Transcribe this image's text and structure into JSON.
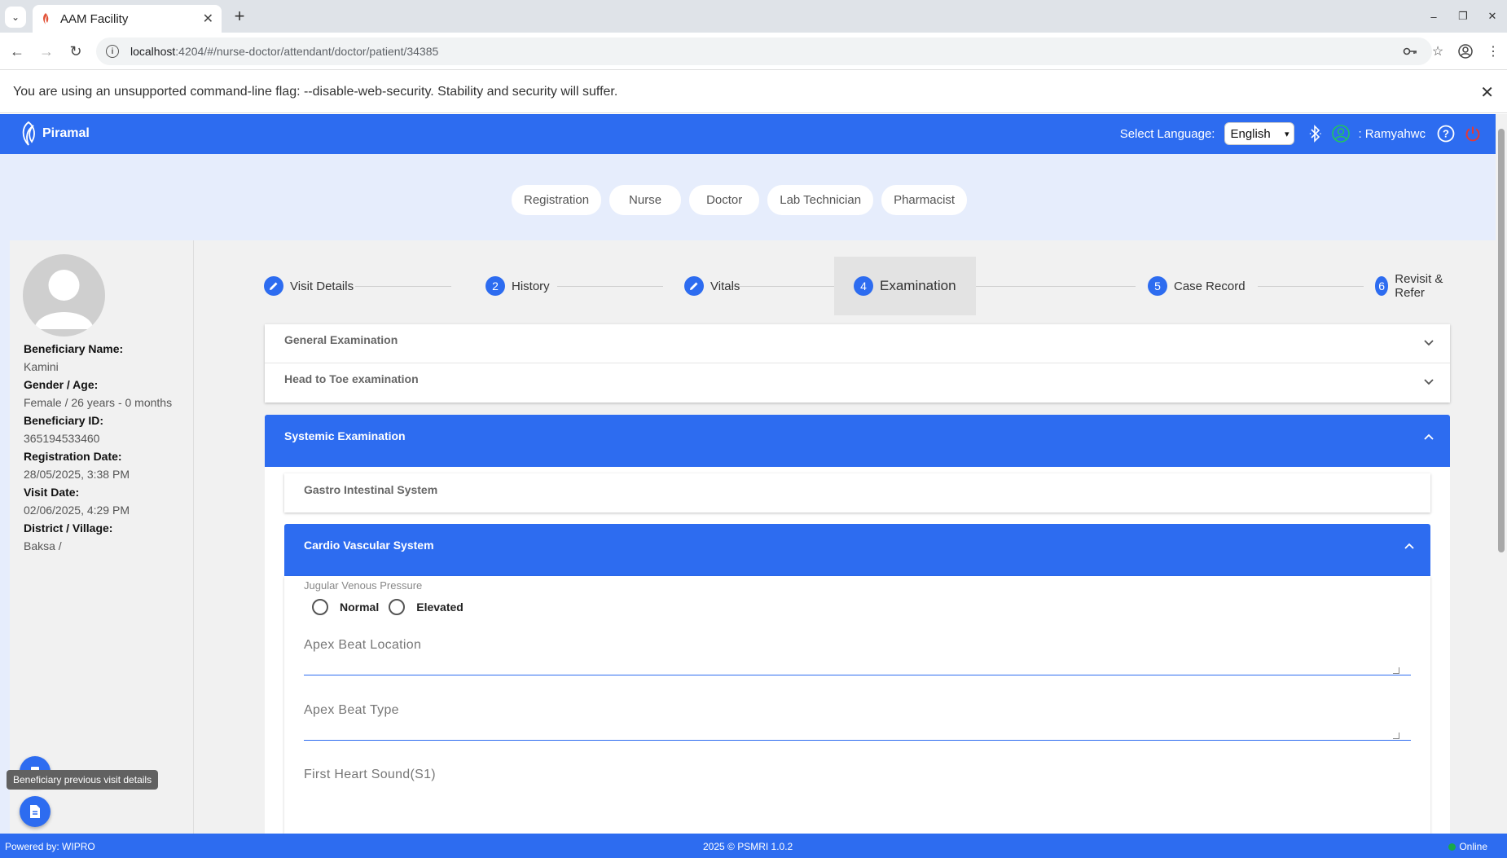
{
  "browser": {
    "tab_title": "AAM Facility",
    "url_host": "localhost",
    "url_path": ":4204/#/nurse-doctor/attendant/doctor/patient/34385",
    "infobar_text": "You are using an unsupported command-line flag: --disable-web-security. Stability and security will suffer."
  },
  "header": {
    "logo_text": "Piramal",
    "language_label": "Select Language:",
    "language_value": "English",
    "user_name": ": Ramyahwc",
    "brand_color": "#2d6cf0"
  },
  "role_tabs": [
    "Registration",
    "Nurse",
    "Doctor",
    "Lab Technician",
    "Pharmacist"
  ],
  "patient": {
    "name_label": "Beneficiary Name:",
    "name": "Kamini",
    "gender_age_label": "Gender / Age:",
    "gender_age": "Female / 26 years - 0 months",
    "id_label": "Beneficiary ID:",
    "id": "365194533460",
    "reg_date_label": "Registration Date:",
    "reg_date": "28/05/2025, 3:38 PM",
    "visit_date_label": "Visit Date:",
    "visit_date": "02/06/2025, 4:29 PM",
    "district_label": "District / Village:",
    "district": "Baksa /"
  },
  "stepper": {
    "steps": [
      {
        "number": "",
        "label": "Visit Details",
        "icon": "pencil-icon"
      },
      {
        "number": "2",
        "label": "History"
      },
      {
        "number": "",
        "label": "Vitals",
        "icon": "pencil-icon"
      },
      {
        "number": "4",
        "label": "Examination"
      },
      {
        "number": "5",
        "label": "Case Record"
      },
      {
        "number": "6",
        "label": "Revisit & Refer"
      }
    ],
    "active_step": "Examination"
  },
  "sections": {
    "general": "General Examination",
    "head_to_toe": "Head to Toe examination",
    "systemic": "Systemic Examination",
    "gastro": "Gastro Intestinal System",
    "cardio": "Cardio Vascular System"
  },
  "cardio_form": {
    "jvp_label": "Jugular Venous Pressure",
    "jvp_options": [
      "Normal",
      "Elevated"
    ],
    "apex_location_label": "Apex Beat Location",
    "apex_type_label": "Apex Beat Type",
    "s1_label": "First Heart Sound(S1)"
  },
  "tooltip": "Beneficiary previous visit details",
  "footer": {
    "left": "Powered by: WIPRO",
    "center": "2025 © PSMRI 1.0.2",
    "status": "Online"
  }
}
